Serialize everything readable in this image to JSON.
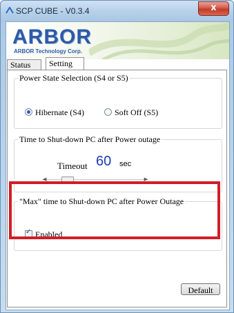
{
  "window": {
    "title": "SCP CUBE - V0.3.4",
    "close_label": "x"
  },
  "banner": {
    "logo_text": "ARBOR",
    "logo_sub": "ARBOR Technology Corp."
  },
  "tabs": [
    {
      "label": "Status",
      "active": false
    },
    {
      "label": "Setting",
      "active": true
    }
  ],
  "power_state": {
    "title": "Power State Selection (S4 or S5)",
    "options": [
      {
        "label": "Hibernate (S4)",
        "selected": true
      },
      {
        "label": "Soft Off (S5)",
        "selected": false
      }
    ]
  },
  "shutdown": {
    "title": "Time to Shut-down PC after Power outage",
    "timeout_label": "Timeout",
    "timeout_value": "60",
    "timeout_unit": "sec"
  },
  "max_shutdown": {
    "title": "\"Max\" time to Shut-down PC after Power Outage",
    "enabled_label": "Enabled",
    "enabled": true
  },
  "default_button": "Default",
  "colors": {
    "highlight": "#d11d27",
    "logo": "#2c5aa8",
    "timeout_value": "#1f39b5"
  }
}
